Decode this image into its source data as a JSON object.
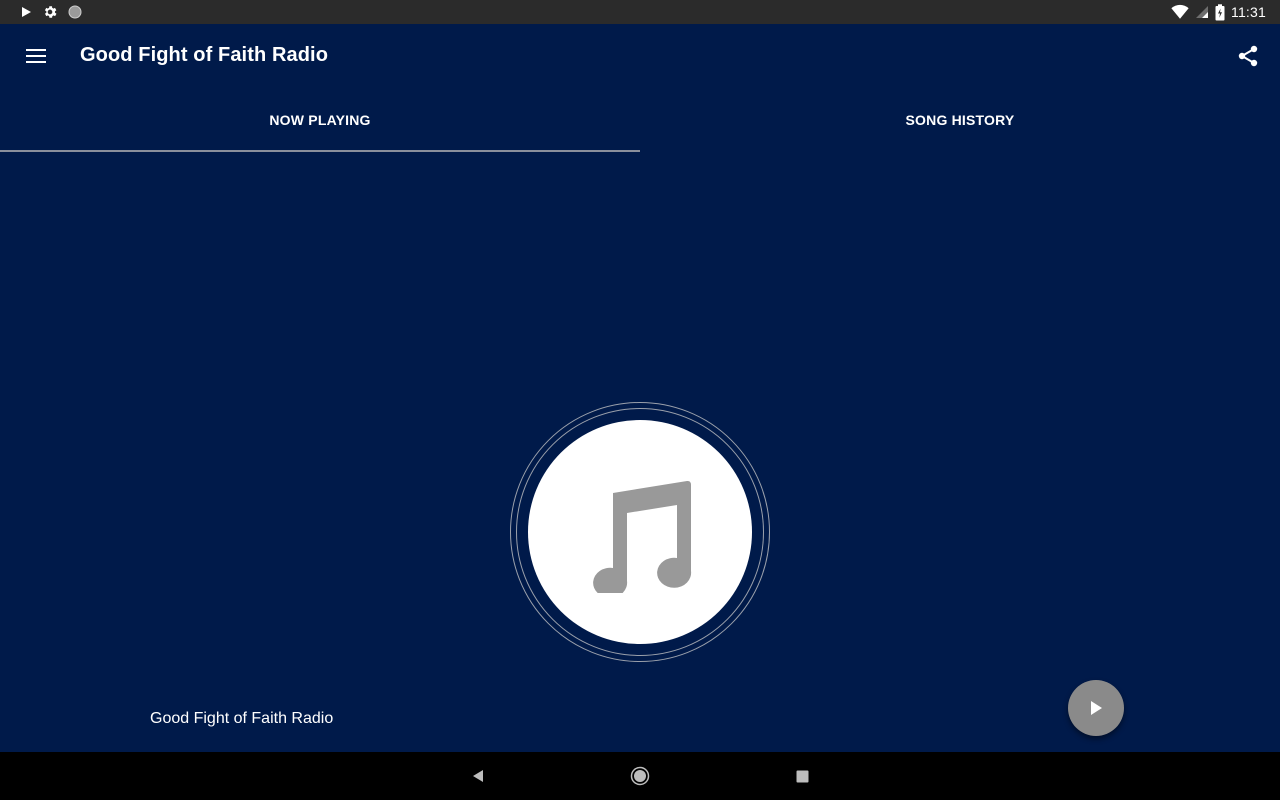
{
  "status_bar": {
    "time": "11:31",
    "left_icons": [
      "play-icon",
      "settings-icon",
      "circle-icon"
    ],
    "right_icons": [
      "wifi-icon",
      "signal-icon",
      "battery-charging-icon"
    ]
  },
  "app_bar": {
    "title": "Good Fight of Faith Radio",
    "menu_icon": "hamburger-menu-icon",
    "share_icon": "share-icon"
  },
  "tabs": [
    {
      "label": "NOW PLAYING",
      "selected": true
    },
    {
      "label": "SONG HISTORY",
      "selected": false
    }
  ],
  "now_playing": {
    "artwork_icon": "music-note-icon",
    "station_name": "Good Fight of Faith Radio",
    "play_icon": "play-icon"
  },
  "nav_bar": {
    "icons": [
      "back-icon",
      "home-icon",
      "recents-icon"
    ]
  },
  "colors": {
    "background": "#001a4a",
    "status_bar": "#2b2b2b",
    "tab_indicator": "#8a8f9c",
    "fab": "#8a8a8a",
    "artwork_note": "#999999"
  }
}
